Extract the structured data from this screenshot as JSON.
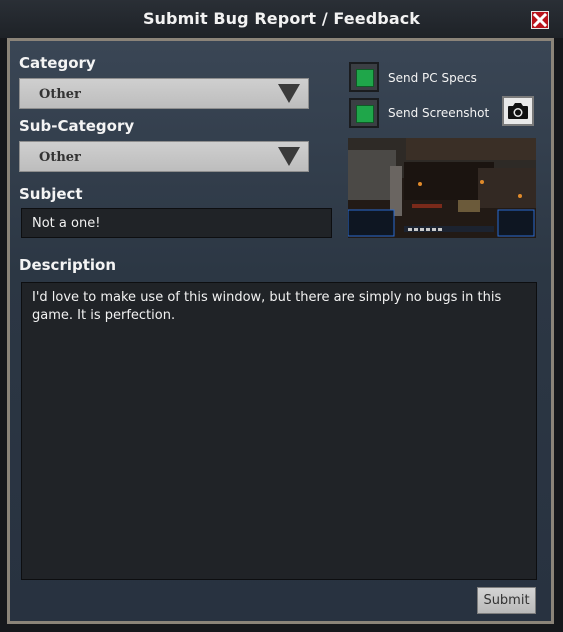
{
  "window": {
    "title": "Submit Bug Report / Feedback"
  },
  "form": {
    "category_label": "Category",
    "category_value": "Other",
    "subcategory_label": "Sub-Category",
    "subcategory_value": "Other",
    "subject_label": "Subject",
    "subject_value": "Not a one!",
    "description_label": "Description",
    "description_value": "I'd love to make use of this window, but there are simply no bugs in this game. It is perfection.",
    "submit_label": "Submit"
  },
  "options": {
    "send_pc_specs_label": "Send PC Specs",
    "send_pc_specs_checked": true,
    "send_screenshot_label": "Send Screenshot",
    "send_screenshot_checked": true
  },
  "colors": {
    "checkbox_green": "#1fa64a",
    "close_red": "#b8141c",
    "panel_bg": "#2c3744"
  },
  "icons": {
    "close": "close-icon",
    "camera": "camera-icon",
    "dropdown": "triangle-down-icon"
  }
}
